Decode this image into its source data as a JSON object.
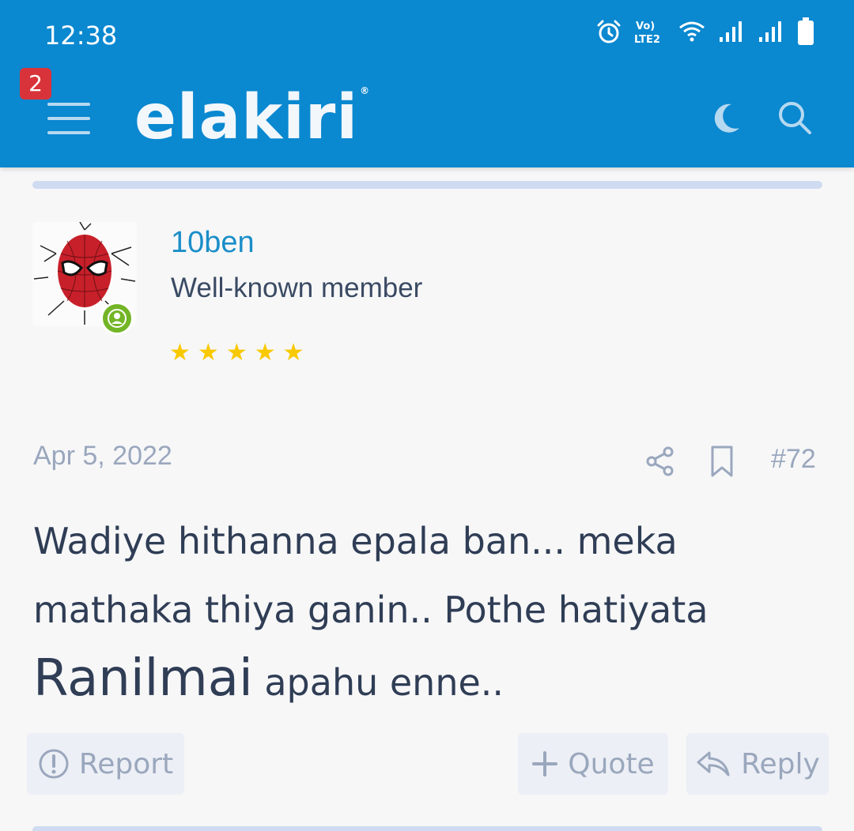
{
  "status_bar": {
    "time": "12:38",
    "icons": [
      "alarm-icon",
      "volte-icon",
      "wifi-icon",
      "signal-icon",
      "signal-icon",
      "battery-icon"
    ],
    "volte_label": "Vo) LTE2"
  },
  "header": {
    "notification_count": "2",
    "logo_text": "elakiri",
    "logo_mark": "®",
    "icons": {
      "menu": "menu-icon",
      "theme": "moon-icon",
      "search": "search-icon"
    },
    "bg_color": "#0a88d0"
  },
  "post": {
    "author": {
      "username": "10ben",
      "title": "Well-known member",
      "rating_stars": 5,
      "online": true
    },
    "date": "Apr 5, 2022",
    "number": "#72",
    "body": {
      "part1": "Wadiye hithanna epala ban... meka mathaka thiya ganin.. Pothe hatiyata ",
      "emphasis": "Ranilmai",
      "part2": " apahu enne.."
    },
    "actions": {
      "report_label": "Report",
      "quote_label": "Quote",
      "reply_label": "Reply"
    }
  },
  "colors": {
    "accent": "#1a8ec8",
    "muted": "#9aa7bd",
    "text": "#2f3d55",
    "star": "#f9c900",
    "online": "#73b526",
    "badge": "#d8333a"
  }
}
